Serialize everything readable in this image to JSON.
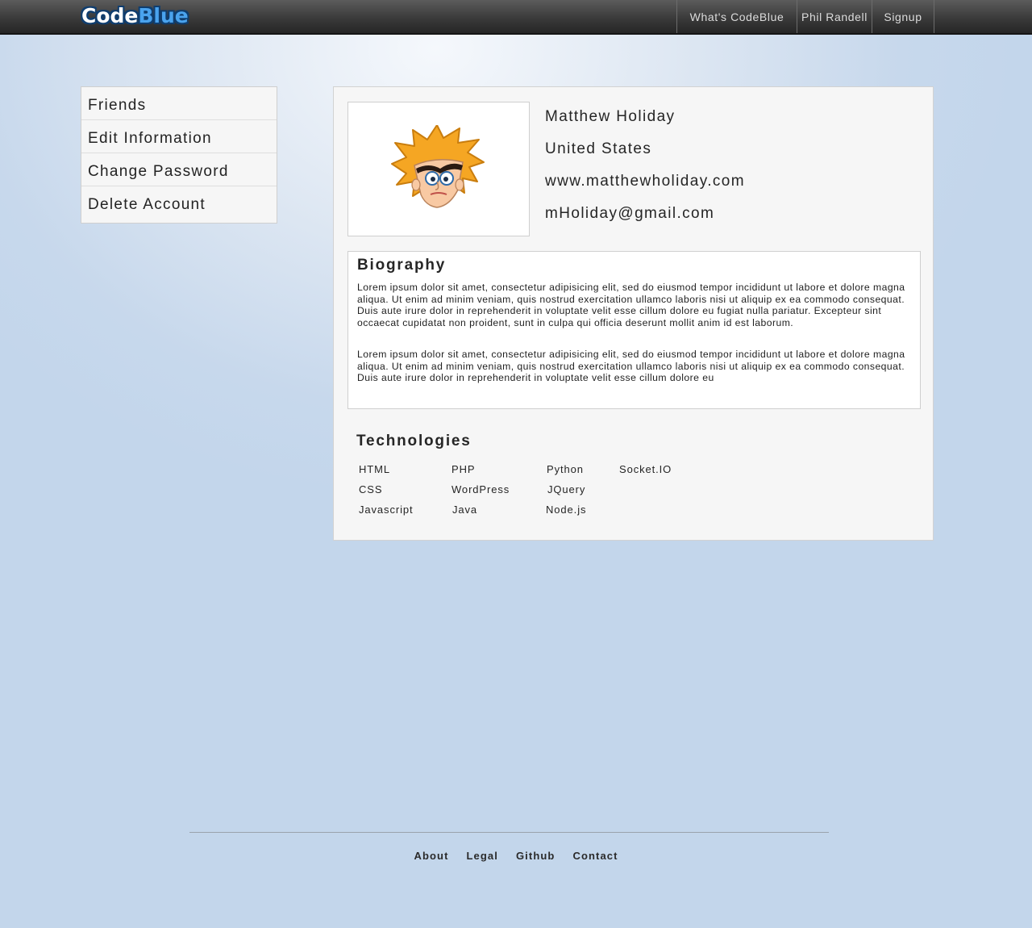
{
  "header": {
    "logo_part1": "Code",
    "logo_part2": "Blue",
    "nav": [
      {
        "label": "What's CodeBlue"
      },
      {
        "label": "Phil Randell"
      },
      {
        "label": "Signup"
      }
    ]
  },
  "sidebar": {
    "items": [
      {
        "label": "Friends"
      },
      {
        "label": "Edit Information"
      },
      {
        "label": "Change Password"
      },
      {
        "label": "Delete Account"
      }
    ]
  },
  "profile": {
    "name": "Matthew Holiday",
    "country": "United States",
    "website": "www.matthewholiday.com",
    "email": "mHoliday@gmail.com"
  },
  "biography": {
    "title": "Biography",
    "paragraph1": "Lorem ipsum dolor sit amet, consectetur adipisicing elit, sed do eiusmod tempor incididunt ut labore et dolore magna aliqua. Ut enim ad minim veniam, quis nostrud exercitation ullamco laboris nisi ut aliquip ex ea commodo consequat. Duis aute irure dolor in reprehenderit in voluptate velit esse cillum dolore eu fugiat nulla pariatur. Excepteur sint occaecat cupidatat non proident, sunt in culpa qui officia deserunt mollit anim id est laborum.",
    "paragraph2": "Lorem ipsum dolor sit amet, consectetur adipisicing elit, sed do eiusmod tempor incididunt ut labore et dolore magna aliqua. Ut enim ad minim veniam, quis nostrud exercitation ullamco laboris nisi ut aliquip ex ea commodo consequat. Duis aute irure dolor in reprehenderit in voluptate velit esse cillum dolore eu"
  },
  "technologies": {
    "title": "Technologies",
    "items": [
      "HTML",
      "CSS",
      "Javascript",
      "PHP",
      "WordPress",
      "Java",
      "Python",
      "JQuery",
      "Node.js",
      "Socket.IO"
    ]
  },
  "footer": {
    "links": [
      "About",
      "Legal",
      "Github",
      "Contact"
    ]
  },
  "avatar_icon": "cartoon-avatar-icon"
}
